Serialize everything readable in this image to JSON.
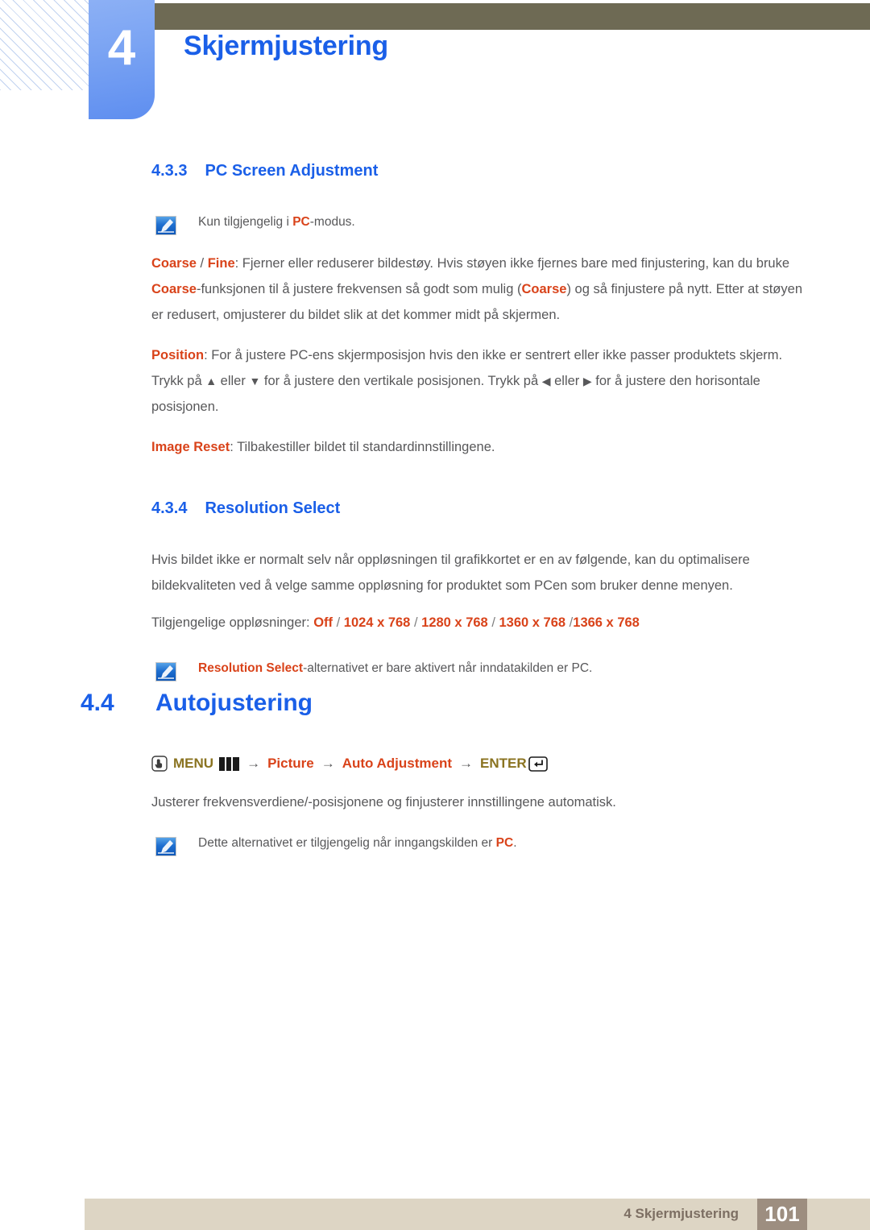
{
  "header": {
    "chapter_number": "4",
    "chapter_title": "Skjermjustering",
    "accent_blue": "#1a5fe8",
    "olive_bar_color": "#6e6a54"
  },
  "sections": {
    "pc_screen_adjustment": {
      "number": "4.3.3",
      "title": "PC Screen Adjustment",
      "note": {
        "icon": "note-pencil-icon",
        "prefix": "Kun tilgjengelig i ",
        "highlight": "PC",
        "suffix": "-modus."
      },
      "coarse_fine": {
        "term1": "Coarse",
        "slash": " / ",
        "term2": "Fine",
        "text1": ": Fjerner eller reduserer bildestøy. Hvis støyen ikke fjernes bare med finjustering, kan du bruke ",
        "term3": "Coarse",
        "text2": "-funksjonen til å justere frekvensen så godt som mulig (",
        "term4": "Coarse",
        "text3": ") og så finjustere på nytt. Etter at støyen er redusert, omjusterer du bildet slik at det kommer midt på skjermen."
      },
      "position": {
        "term": "Position",
        "text1": ": For å justere PC-ens skjermposisjon hvis den ikke er sentrert eller ikke passer produktets skjerm. Trykk på ",
        "arrow_up": "▲",
        "text2": " eller ",
        "arrow_down": "▼",
        "text3": " for å justere den vertikale posisjonen. Trykk på ",
        "arrow_left": "◀",
        "text4": " eller ",
        "arrow_right": "▶",
        "text5": " for å justere den horisontale posisjonen."
      },
      "image_reset": {
        "term": "Image Reset",
        "text": ": Tilbakestiller bildet til standardinnstillingene."
      }
    },
    "resolution_select": {
      "number": "4.3.4",
      "title": "Resolution Select",
      "intro": "Hvis bildet ikke er normalt selv når oppløsningen til grafikkortet er en av følgende, kan du optimalisere bildekvaliteten ved å velge samme oppløsning for produktet som PCen som bruker denne menyen.",
      "available_label": "Tilgjengelige oppløsninger: ",
      "resolutions": [
        "Off",
        "1024 x 768",
        "1280 x 768",
        "1360 x 768",
        "1366 x 768"
      ],
      "note": {
        "icon": "note-pencil-icon",
        "highlight": "Resolution Select",
        "suffix": "-alternativet er bare aktivert når inndatakilden er PC."
      }
    },
    "autojustering": {
      "number": "4.4",
      "title": "Autojustering",
      "menu_path": {
        "hand_icon": "hand-press-icon",
        "menu_label": "MENU",
        "bars_icon": "menu-bars-icon",
        "arrow": "→",
        "item1": "Picture",
        "item2": "Auto Adjustment",
        "enter_label": "ENTER",
        "enter_icon": "enter-key-icon"
      },
      "description": "Justerer frekvensverdiene/-posisjonene og finjusterer innstillingene automatisk.",
      "note": {
        "icon": "note-pencil-icon",
        "prefix": "Dette alternativet er tilgjengelig når inngangskilden er ",
        "highlight": "PC",
        "suffix": "."
      }
    }
  },
  "footer": {
    "label": "4 Skjermjustering",
    "page_number": "101"
  }
}
